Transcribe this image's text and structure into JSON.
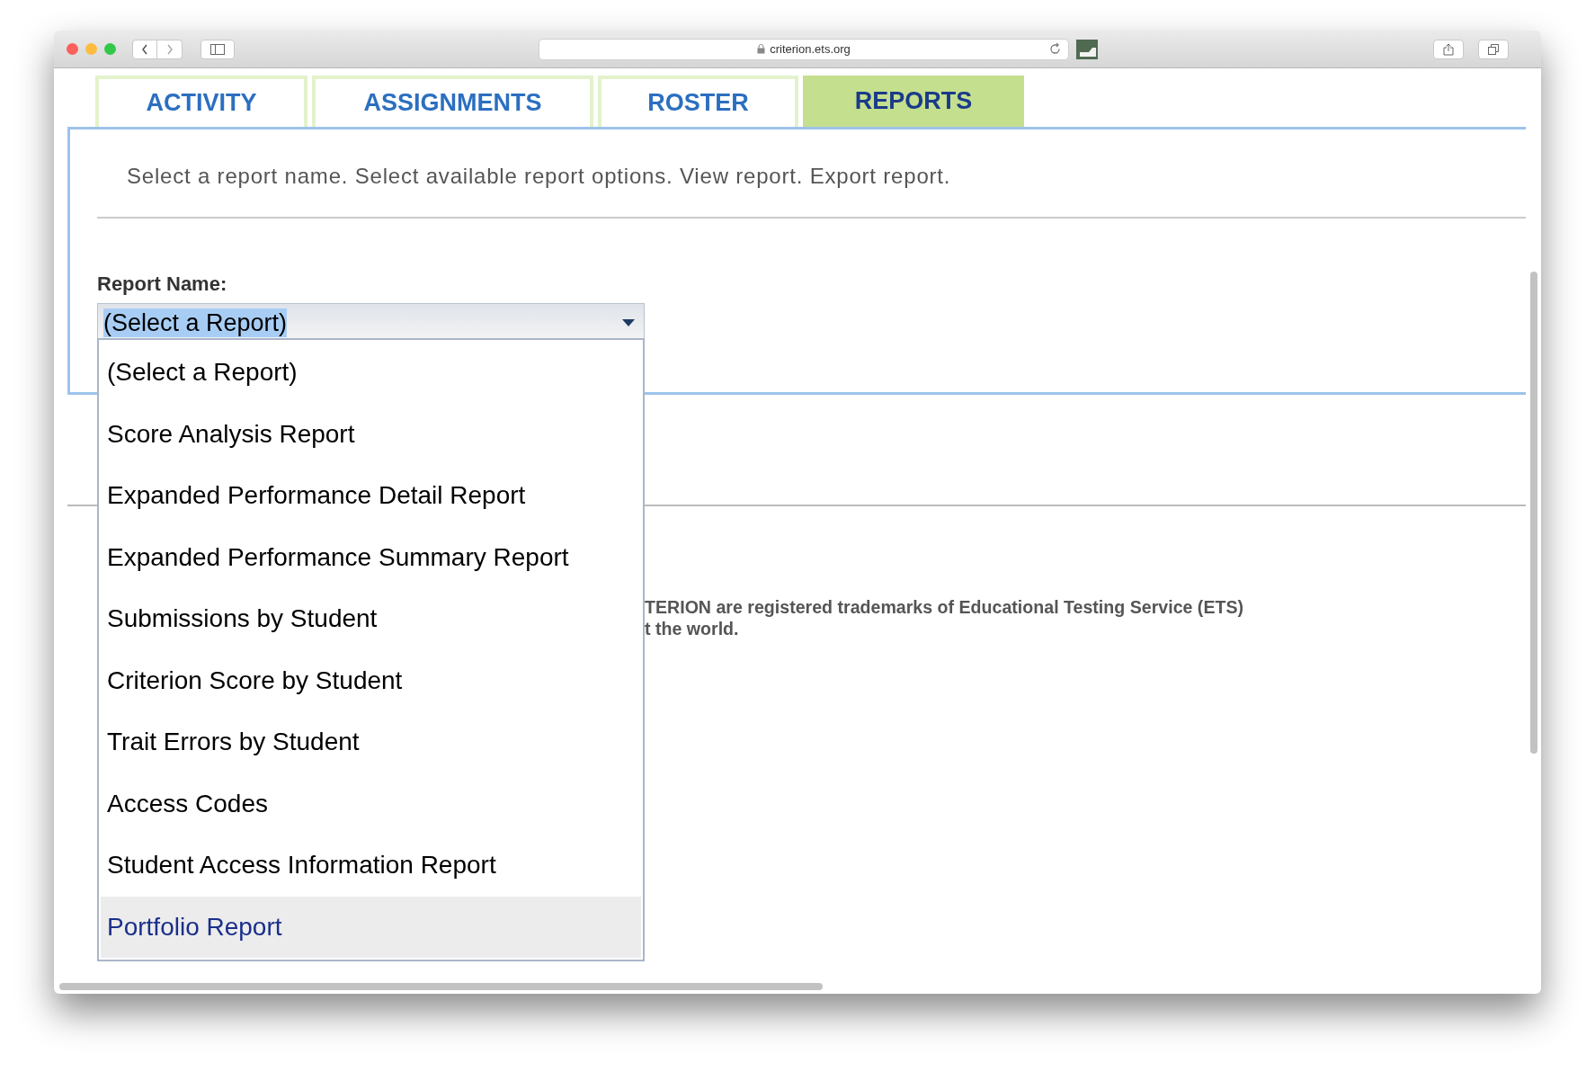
{
  "browser": {
    "url": "criterion.ets.org"
  },
  "tabs": [
    {
      "label": "ACTIVITY",
      "selected": false
    },
    {
      "label": "ASSIGNMENTS",
      "selected": false
    },
    {
      "label": "ROSTER",
      "selected": false
    },
    {
      "label": "REPORTS",
      "selected": true
    }
  ],
  "instructions": "Select a report name. Select available report options. View report. Export report.",
  "report_name": {
    "label": "Report Name:",
    "value": "(Select a Report)",
    "expanded": true,
    "options": [
      {
        "label": "(Select a Report)",
        "highlighted": false
      },
      {
        "label": "Score Analysis Report",
        "highlighted": false
      },
      {
        "label": "Expanded Performance Detail Report",
        "highlighted": false
      },
      {
        "label": "Expanded Performance Summary Report",
        "highlighted": false
      },
      {
        "label": "Submissions by Student",
        "highlighted": false
      },
      {
        "label": "Criterion Score by Student",
        "highlighted": false
      },
      {
        "label": "Trait Errors by Student",
        "highlighted": false
      },
      {
        "label": "Access Codes",
        "highlighted": false
      },
      {
        "label": "Student Access Information Report",
        "highlighted": false
      },
      {
        "label": "Portfolio Report",
        "highlighted": true
      }
    ]
  },
  "footer": [
    "TERION are registered trademarks of Educational Testing Service (ETS)",
    "t the world."
  ]
}
